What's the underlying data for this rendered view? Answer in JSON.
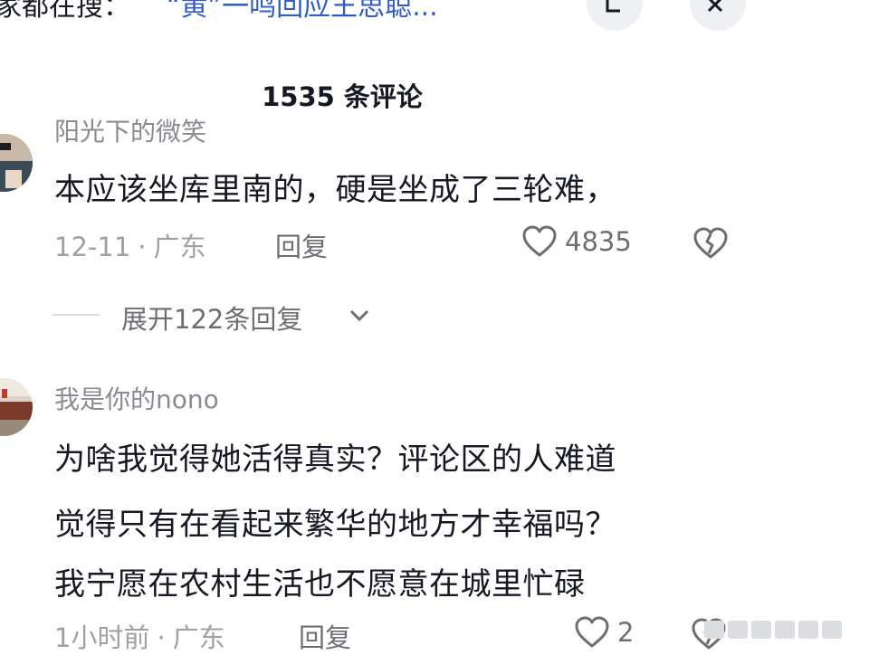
{
  "search_bar": {
    "prefix": "家都在搜：",
    "query": "“黄”一鸣回应王思聪..."
  },
  "header": {
    "title": "1535 条评论"
  },
  "comments": [
    {
      "username": "阳光下的微笑",
      "lines": [
        "本应该坐库里南的，硬是坐成了三轮难，"
      ],
      "time": "12-11",
      "location": "广东",
      "reply_label": "回复",
      "likes": "4835"
    },
    {
      "username": "我是你的nono",
      "lines": [
        "为啥我觉得她活得真实？评论区的人难道",
        "觉得只有在看起来繁华的地方才幸福吗？",
        "我宁愿在农村生活也不愿意在城里忙碌"
      ],
      "time": "1小时前",
      "location": "广东",
      "reply_label": "回复",
      "likes": "2"
    }
  ],
  "expand_replies": {
    "label": "展开122条回复"
  },
  "icons": {
    "like": "heart-outline-icon",
    "dislike": "broken-heart-icon",
    "expand": "chevron-down-icon",
    "top_right_1": "letter-icon",
    "top_right_2": "close-icon"
  },
  "colors": {
    "text": "#161823",
    "meta": "#9fa0a5",
    "link": "#2f5cc6",
    "button_bg": "#eef0f4"
  }
}
